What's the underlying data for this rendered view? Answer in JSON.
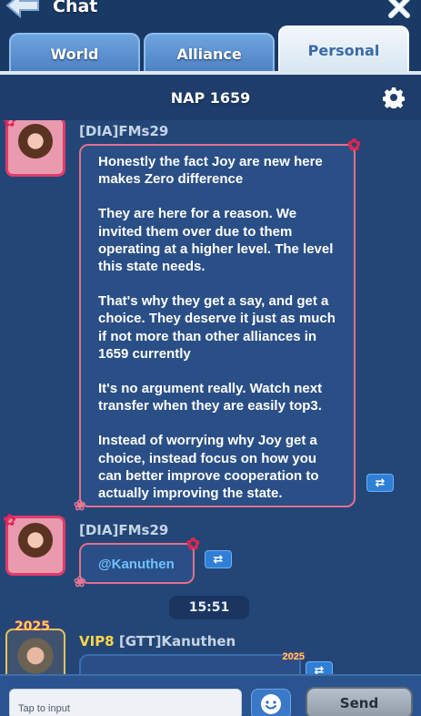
{
  "header": {
    "title": "Chat",
    "back_icon": "back-arrow-icon",
    "close_icon": "close-icon"
  },
  "tabs": [
    {
      "label": "World",
      "active": false
    },
    {
      "label": "Alliance",
      "active": false
    },
    {
      "label": "Personal",
      "active": true
    }
  ],
  "room": {
    "title": "NAP 1659",
    "settings_icon": "gear-icon"
  },
  "messages": [
    {
      "sender": "[DIA]FMs29",
      "paragraphs": [
        "Honestly the fact Joy are new here makes Zero difference",
        "They are here for a reason. We invited them over due to them operating at a higher level. The level this state needs.",
        "That's why they get a say, and get a choice. They deserve it just as much if not more than other alliances in 1659 currently",
        "It's no argument really. Watch next transfer when they are easily top3.",
        "Instead of worrying why Joy get a choice, instead focus on how you can better improve cooperation to actually improving the state."
      ]
    },
    {
      "sender": "[DIA]FMs29",
      "mention": "@Kanuthen"
    },
    {
      "timestamp": "15:51"
    },
    {
      "vip": "VIP8",
      "sender": "[GTT]Kanuthen",
      "avatar_badge": "2025",
      "bubble_badge": "2025"
    }
  ],
  "input": {
    "placeholder": "Tap to input",
    "emoji_icon": "smiley-icon",
    "send_label": "Send"
  },
  "colors": {
    "background": "#234677",
    "bubble_border": "#e2708c",
    "mention": "#6fc1ff",
    "vip": "#ffd54a"
  }
}
